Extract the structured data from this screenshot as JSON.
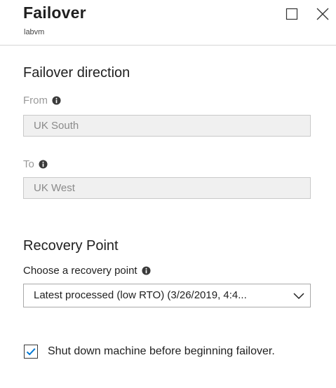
{
  "header": {
    "title": "Failover",
    "subtitle": "labvm",
    "maximize_icon": "maximize-icon",
    "close_icon": "close-icon"
  },
  "failover_direction": {
    "heading": "Failover direction",
    "from": {
      "label": "From",
      "value": "UK South"
    },
    "to": {
      "label": "To",
      "value": "UK West"
    }
  },
  "recovery_point": {
    "heading": "Recovery Point",
    "label": "Choose a recovery point",
    "selected": "Latest processed (low RTO) (3/26/2019, 4:4..."
  },
  "shutdown": {
    "checked": true,
    "label": "Shut down machine before beginning failover."
  },
  "colors": {
    "accent": "#0078d4",
    "disabled_text": "#9a9a9a",
    "readonly_bg": "#f0f0f0"
  }
}
